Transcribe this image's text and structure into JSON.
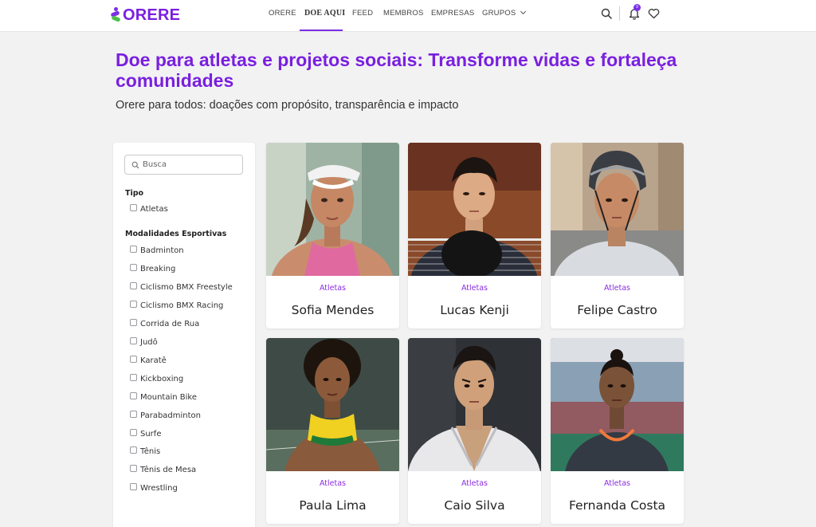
{
  "header": {
    "brand": "ORERE",
    "nav": [
      {
        "label": "ORERE"
      },
      {
        "label": "DOE AQUI"
      },
      {
        "label": "FEED"
      },
      {
        "label": "MEMBROS"
      },
      {
        "label": "EMPRESAS"
      },
      {
        "label": "GRUPOS"
      }
    ],
    "notification_count": "9",
    "icons": [
      "search-icon",
      "bell-icon",
      "heart-icon"
    ]
  },
  "hero": {
    "title": "Doe para atletas e projetos sociais: Transforme vidas e fortaleça comunidades",
    "subtitle": "Orere para todos: doações com propósito, transparência e impacto"
  },
  "filters": {
    "search_placeholder": "Busca",
    "type_title": "Tipo",
    "type_options": [
      "Atletas"
    ],
    "sports_title": "Modalidades Esportivas",
    "sports_options": [
      "Badminton",
      "Breaking",
      "Ciclismo BMX Freestyle",
      "Ciclismo BMX Racing",
      "Corrida de Rua",
      "Judô",
      "Karatê",
      "Kickboxing",
      "Mountain Bike",
      "Parabadminton",
      "Surfe",
      "Tênis",
      "Tênis de Mesa",
      "Wrestling"
    ]
  },
  "cards": [
    {
      "type": "Atletas",
      "name": "Sofia Mendes"
    },
    {
      "type": "Atletas",
      "name": "Lucas Kenji"
    },
    {
      "type": "Atletas",
      "name": "Felipe Castro"
    },
    {
      "type": "Atletas",
      "name": "Paula Lima"
    },
    {
      "type": "Atletas",
      "name": "Caio Silva"
    },
    {
      "type": "Atletas",
      "name": "Fernanda Costa"
    }
  ],
  "colors": {
    "brand": "#7a1fe0",
    "accent": "#8a2be2",
    "background": "#f2f2f3"
  }
}
